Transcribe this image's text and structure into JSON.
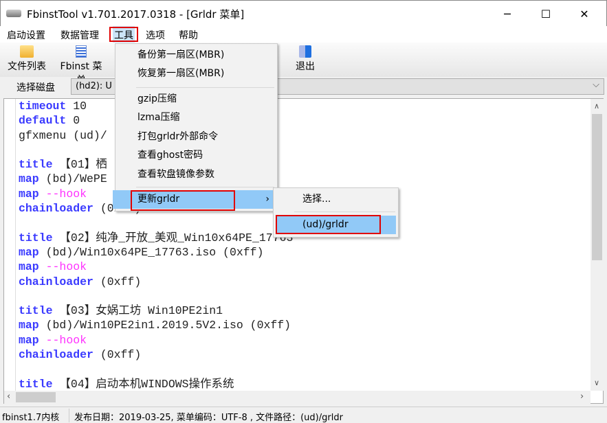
{
  "window": {
    "title": "FbinstTool v1.701.2017.0318 - [Grldr 菜单]",
    "minimize": "─",
    "maximize": "☐",
    "close": "✕"
  },
  "menubar": [
    "启动设置",
    "数据管理",
    "工具",
    "选项",
    "帮助"
  ],
  "toolbar": {
    "file_list": "文件列表",
    "fbinst_menu": "Fbinst 菜单",
    "exit": "退出"
  },
  "disk": {
    "label": "选择磁盘",
    "value": "(hd2): U",
    "chevron": "⌵"
  },
  "tools_menu": {
    "items": [
      "备份第一扇区(MBR)",
      "恢复第一扇区(MBR)",
      "gzip压缩",
      "lzma压缩",
      "打包grldr外部命令",
      "查看ghost密码",
      "查看软盘镜像参数",
      "更新grldr"
    ],
    "submenu_arrow": "›"
  },
  "submenu": {
    "items": [
      "选择...",
      "(ud)/grldr"
    ]
  },
  "editor": {
    "lines": [
      [
        [
          "kw",
          "timeout"
        ],
        [
          "tx",
          " 10"
        ]
      ],
      [
        [
          "kw",
          "default"
        ],
        [
          "tx",
          " 0"
        ]
      ],
      [
        [
          "tx",
          "gfxmenu (ud)/"
        ]
      ],
      [],
      [
        [
          "kw",
          "title"
        ],
        [
          "tx",
          " 【01】栖"
        ]
      ],
      [
        [
          "kw",
          "map"
        ],
        [
          "tx",
          " (bd)/WePE"
        ]
      ],
      [
        [
          "kw",
          "map"
        ],
        [
          "pk",
          " --hook"
        ]
      ],
      [
        [
          "kw",
          "chainloader"
        ],
        [
          "tx",
          " (0xff)"
        ]
      ],
      [],
      [
        [
          "kw",
          "title"
        ],
        [
          "tx",
          " 【02】纯净_开放_美观_Win10x64PE_17763"
        ]
      ],
      [
        [
          "kw",
          "map"
        ],
        [
          "tx",
          " (bd)/Win10x64PE_17763.iso (0xff)"
        ]
      ],
      [
        [
          "kw",
          "map"
        ],
        [
          "pk",
          " --hook"
        ]
      ],
      [
        [
          "kw",
          "chainloader"
        ],
        [
          "tx",
          " (0xff)"
        ]
      ],
      [],
      [
        [
          "kw",
          "title"
        ],
        [
          "tx",
          " 【03】女娲工坊 Win10PE2in1"
        ]
      ],
      [
        [
          "kw",
          "map"
        ],
        [
          "tx",
          " (bd)/Win10PE2in1.2019.5V2.iso (0xff)"
        ]
      ],
      [
        [
          "kw",
          "map"
        ],
        [
          "pk",
          " --hook"
        ]
      ],
      [
        [
          "kw",
          "chainloader"
        ],
        [
          "tx",
          " (0xff)"
        ]
      ],
      [],
      [
        [
          "kw",
          "title"
        ],
        [
          "tx",
          " 【04】启动本机WINDOWS操作系统"
        ]
      ]
    ]
  },
  "status": {
    "kernel": "fbinst1.7内核",
    "info": "发布日期：2019-03-25, 菜单编码：UTF-8 , 文件路径：(ud)/grldr"
  },
  "colors": {
    "highlight": "#91c9f7",
    "annotation": "#e00000",
    "keyword": "#3a3aff",
    "option": "#ff33ff"
  }
}
